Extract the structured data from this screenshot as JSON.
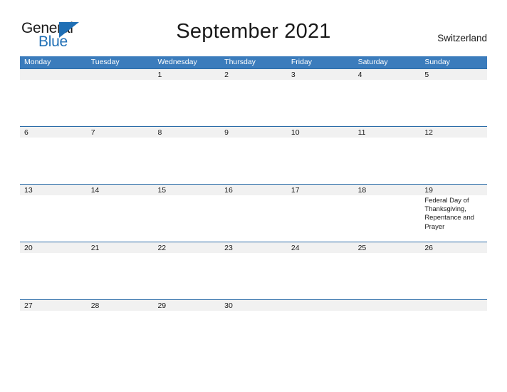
{
  "brand": {
    "name_part1": "General",
    "name_part2": "Blue",
    "triangle_color": "#1f6fb5",
    "text_color_primary": "#1a1a1a",
    "text_color_accent": "#1f6fb5"
  },
  "header": {
    "title": "September 2021",
    "country": "Switzerland"
  },
  "theme": {
    "header_blue": "#3b7cbc",
    "row_border_blue": "#2b6ca8",
    "day_band_gray": "#f1f1f1",
    "page_background": "#ffffff"
  },
  "weekdays": [
    {
      "label": "Monday"
    },
    {
      "label": "Tuesday"
    },
    {
      "label": "Wednesday"
    },
    {
      "label": "Thursday"
    },
    {
      "label": "Friday"
    },
    {
      "label": "Saturday"
    },
    {
      "label": "Sunday"
    }
  ],
  "weeks": [
    {
      "days": [
        {
          "number": "",
          "events": ""
        },
        {
          "number": "",
          "events": ""
        },
        {
          "number": "1",
          "events": ""
        },
        {
          "number": "2",
          "events": ""
        },
        {
          "number": "3",
          "events": ""
        },
        {
          "number": "4",
          "events": ""
        },
        {
          "number": "5",
          "events": ""
        }
      ]
    },
    {
      "days": [
        {
          "number": "6",
          "events": ""
        },
        {
          "number": "7",
          "events": ""
        },
        {
          "number": "8",
          "events": ""
        },
        {
          "number": "9",
          "events": ""
        },
        {
          "number": "10",
          "events": ""
        },
        {
          "number": "11",
          "events": ""
        },
        {
          "number": "12",
          "events": ""
        }
      ]
    },
    {
      "days": [
        {
          "number": "13",
          "events": ""
        },
        {
          "number": "14",
          "events": ""
        },
        {
          "number": "15",
          "events": ""
        },
        {
          "number": "16",
          "events": ""
        },
        {
          "number": "17",
          "events": ""
        },
        {
          "number": "18",
          "events": ""
        },
        {
          "number": "19",
          "events": "Federal Day of Thanksgiving, Repentance and Prayer"
        }
      ]
    },
    {
      "days": [
        {
          "number": "20",
          "events": ""
        },
        {
          "number": "21",
          "events": ""
        },
        {
          "number": "22",
          "events": ""
        },
        {
          "number": "23",
          "events": ""
        },
        {
          "number": "24",
          "events": ""
        },
        {
          "number": "25",
          "events": ""
        },
        {
          "number": "26",
          "events": ""
        }
      ]
    },
    {
      "days": [
        {
          "number": "27",
          "events": ""
        },
        {
          "number": "28",
          "events": ""
        },
        {
          "number": "29",
          "events": ""
        },
        {
          "number": "30",
          "events": ""
        },
        {
          "number": "",
          "events": ""
        },
        {
          "number": "",
          "events": ""
        },
        {
          "number": "",
          "events": ""
        }
      ]
    }
  ]
}
